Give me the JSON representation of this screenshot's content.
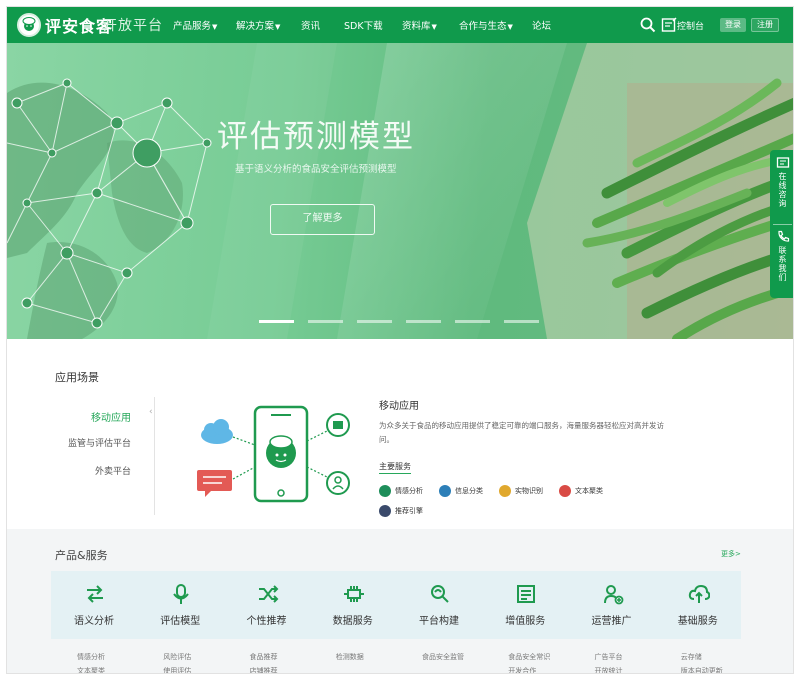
{
  "brand": {
    "logo_text": "评安食客",
    "logo_subtitle": "开放平台"
  },
  "nav": {
    "items": [
      "产品服务",
      "解决方案",
      "资讯",
      "SDK下载",
      "资料库",
      "合作与生态",
      "论坛"
    ],
    "console": "控制台",
    "login": "登录",
    "register": "注册"
  },
  "banner": {
    "title": "评估预测模型",
    "subtitle": "基于语义分析的食品安全评估预测模型",
    "button": "了解更多",
    "slide_count": 6,
    "active_slide": 0
  },
  "side_float": {
    "online_consult": "在线咨询",
    "contact_us": "联系我们"
  },
  "scenarios": {
    "title": "应用场景",
    "tabs": [
      "移动应用",
      "监管与评估平台",
      "外卖平台"
    ],
    "active_tab": 0,
    "heading": "移动应用",
    "description": "为众多关于食品的移动应用提供了稳定可靠的端口服务，海量服务器轻松应对高并发访问。",
    "main_services_label": "主要服务",
    "services": [
      {
        "label": "情感分析",
        "color": "#1e8e5a"
      },
      {
        "label": "信息分类",
        "color": "#2d7fb8"
      },
      {
        "label": "实物识别",
        "color": "#e0a82e"
      },
      {
        "label": "文本聚类",
        "color": "#d94b45"
      },
      {
        "label": "推荐引擎",
        "color": "#3a4a6b"
      }
    ]
  },
  "products": {
    "title": "产品&服务",
    "more": "更多>",
    "categories": [
      {
        "label": "语义分析",
        "icon": "swap-arrows-icon",
        "subs": [
          "情感分析",
          "文本聚类"
        ]
      },
      {
        "label": "评估模型",
        "icon": "microphone-icon",
        "subs": [
          "风险评估",
          "使用评估"
        ]
      },
      {
        "label": "个性推荐",
        "icon": "shuffle-icon",
        "subs": [
          "食品推荐",
          "店铺推荐"
        ]
      },
      {
        "label": "数据服务",
        "icon": "chip-icon",
        "subs": [
          "检测数据"
        ]
      },
      {
        "label": "平台构建",
        "icon": "magnify-icon",
        "subs": [
          "食品安全监管"
        ]
      },
      {
        "label": "增值服务",
        "icon": "document-icon",
        "subs": [
          "食品安全常识",
          "开发合作"
        ]
      },
      {
        "label": "运营推广",
        "icon": "user-add-icon",
        "subs": [
          "广告平台",
          "开放统计"
        ]
      },
      {
        "label": "基础服务",
        "icon": "cloud-upload-icon",
        "subs": [
          "云存储",
          "版本自动更新"
        ]
      }
    ]
  }
}
